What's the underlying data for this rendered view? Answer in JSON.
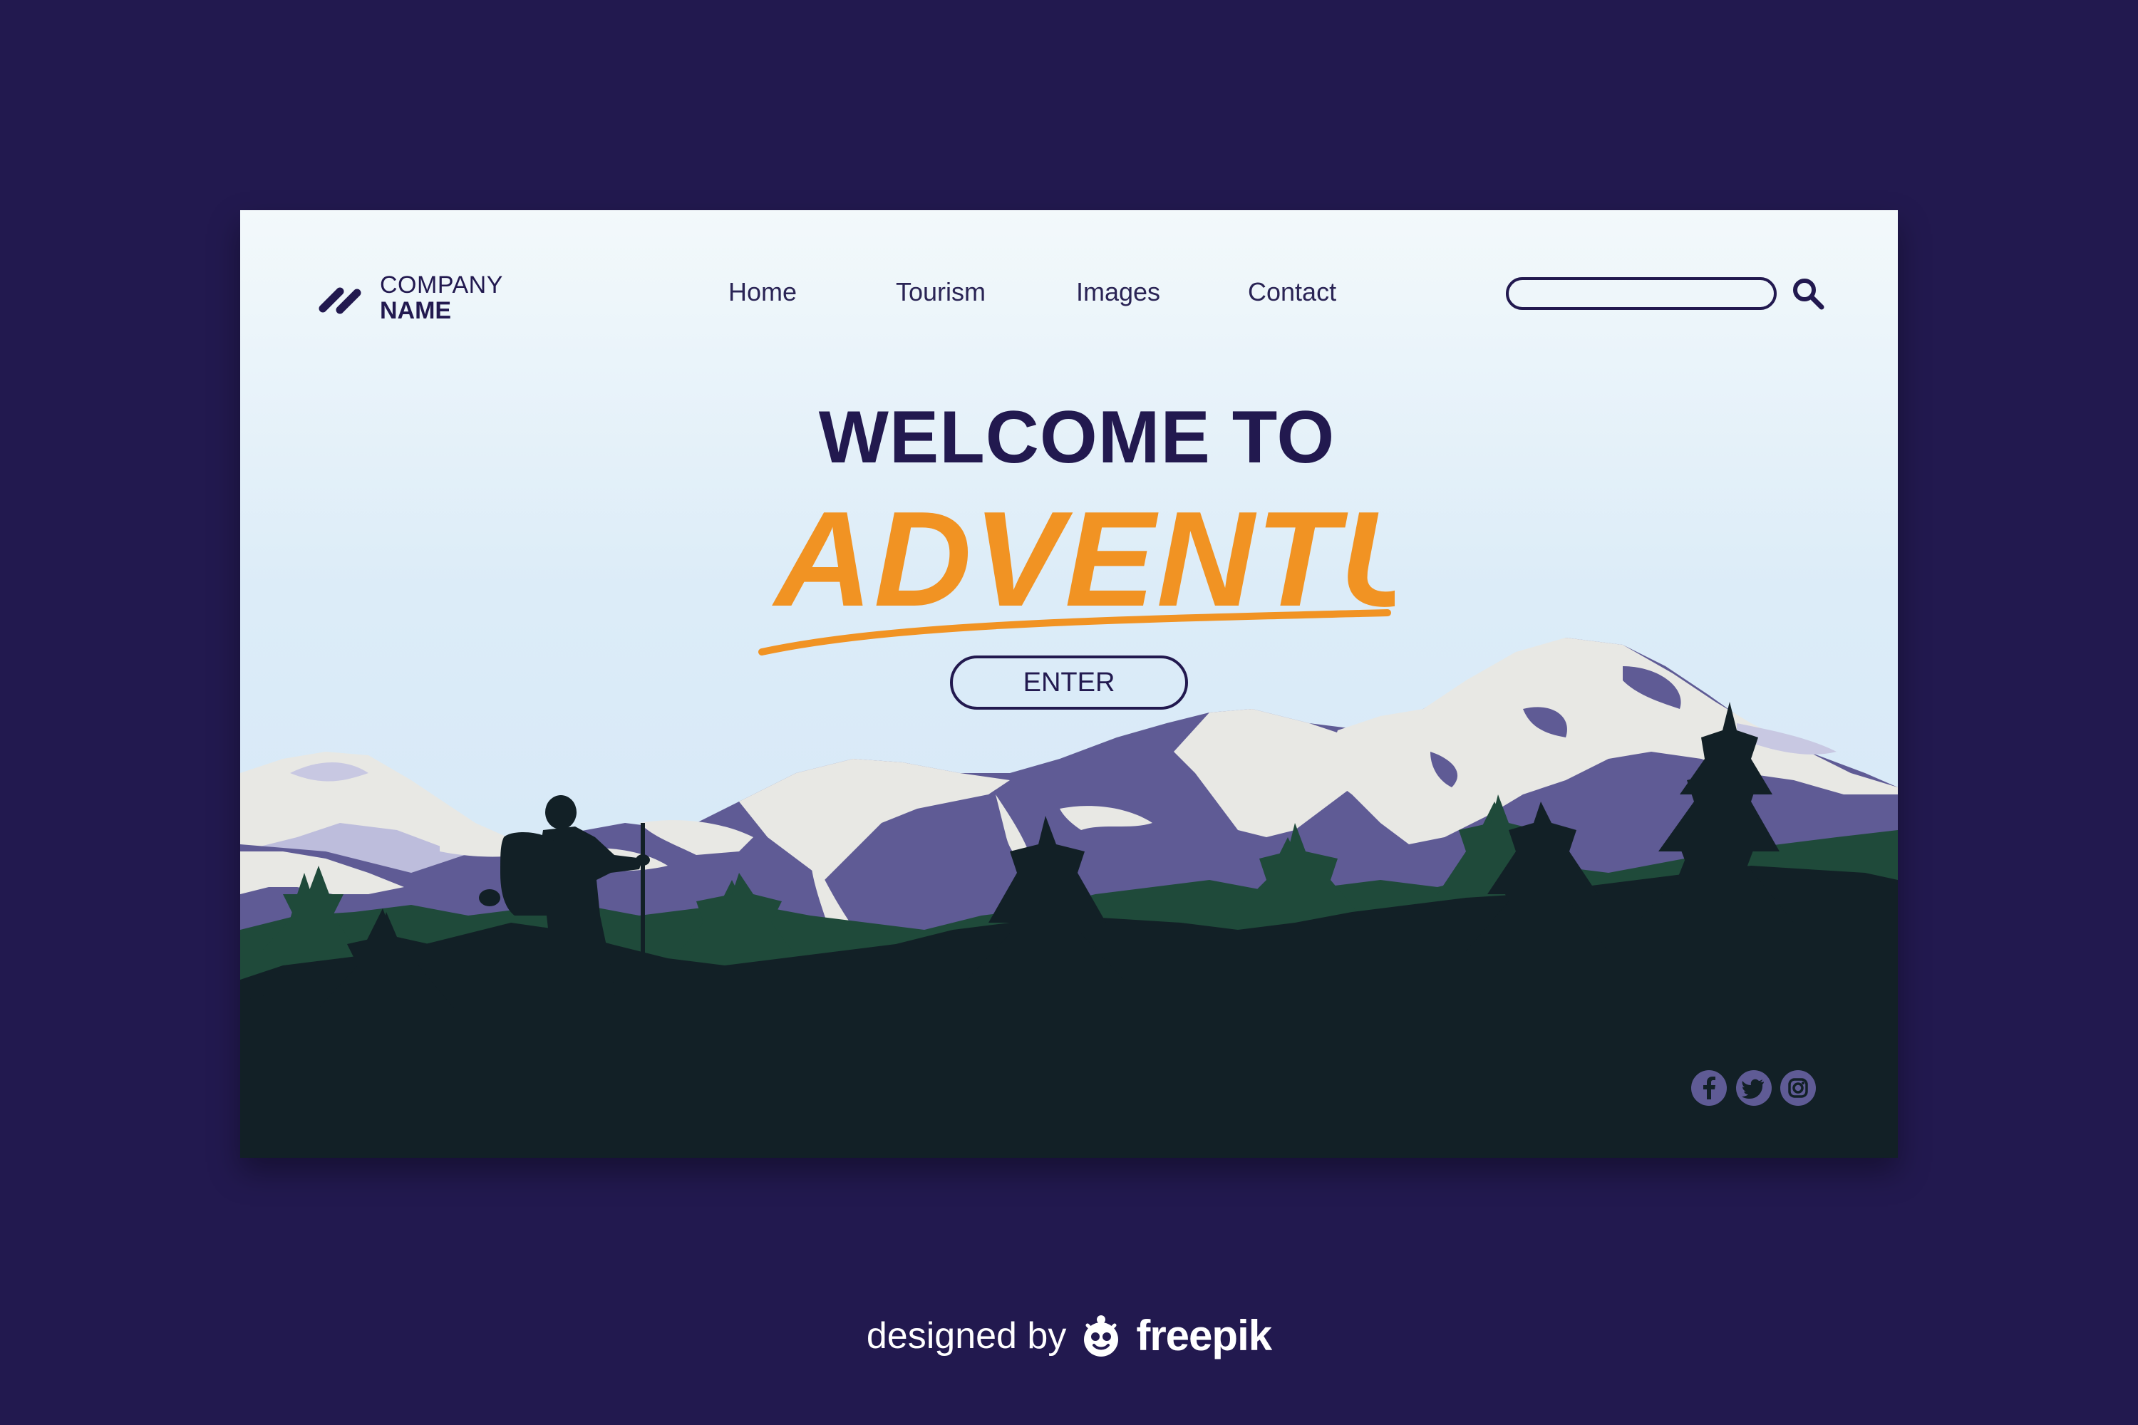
{
  "brand": {
    "logo_icon": "double-slash-logo-icon",
    "name_line1": "COMPANY",
    "name_line2": "NAME"
  },
  "nav": {
    "items": [
      {
        "label": "Home"
      },
      {
        "label": "Tourism"
      },
      {
        "label": "Images"
      },
      {
        "label": "Contact"
      }
    ]
  },
  "search": {
    "value": "",
    "placeholder": "",
    "icon": "search-icon"
  },
  "hero": {
    "welcome": "WELCOME TO",
    "adventure": "ADVENTURE",
    "enter_label": "ENTER"
  },
  "social": [
    {
      "icon": "facebook-icon"
    },
    {
      "icon": "twitter-icon"
    },
    {
      "icon": "instagram-icon"
    }
  ],
  "credit": {
    "prefix": "designed by",
    "brand": "freepik",
    "mascot_icon": "freepik-mascot-icon"
  },
  "colors": {
    "background": "#22194f",
    "accent_orange": "#f19323",
    "navy": "#22194f",
    "mountain_purple": "#5f5b95",
    "snow": "#e8e8e4",
    "forest_green": "#1f4a3a",
    "foreground_dark": "#122026"
  }
}
